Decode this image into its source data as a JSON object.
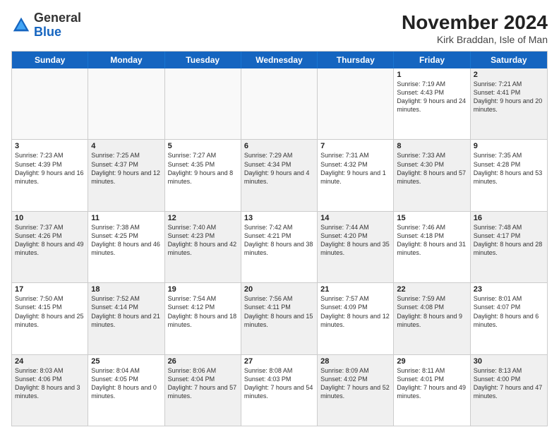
{
  "header": {
    "logo": {
      "line1": "General",
      "line2": "Blue"
    },
    "month_title": "November 2024",
    "subtitle": "Kirk Braddan, Isle of Man"
  },
  "days_of_week": [
    "Sunday",
    "Monday",
    "Tuesday",
    "Wednesday",
    "Thursday",
    "Friday",
    "Saturday"
  ],
  "weeks": [
    [
      {
        "day": "",
        "info": "",
        "empty": true
      },
      {
        "day": "",
        "info": "",
        "empty": true
      },
      {
        "day": "",
        "info": "",
        "empty": true
      },
      {
        "day": "",
        "info": "",
        "empty": true
      },
      {
        "day": "",
        "info": "",
        "empty": true
      },
      {
        "day": "1",
        "info": "Sunrise: 7:19 AM\nSunset: 4:43 PM\nDaylight: 9 hours and 24 minutes.",
        "empty": false,
        "shaded": false
      },
      {
        "day": "2",
        "info": "Sunrise: 7:21 AM\nSunset: 4:41 PM\nDaylight: 9 hours and 20 minutes.",
        "empty": false,
        "shaded": true
      }
    ],
    [
      {
        "day": "3",
        "info": "Sunrise: 7:23 AM\nSunset: 4:39 PM\nDaylight: 9 hours and 16 minutes.",
        "empty": false,
        "shaded": false
      },
      {
        "day": "4",
        "info": "Sunrise: 7:25 AM\nSunset: 4:37 PM\nDaylight: 9 hours and 12 minutes.",
        "empty": false,
        "shaded": true
      },
      {
        "day": "5",
        "info": "Sunrise: 7:27 AM\nSunset: 4:35 PM\nDaylight: 9 hours and 8 minutes.",
        "empty": false,
        "shaded": false
      },
      {
        "day": "6",
        "info": "Sunrise: 7:29 AM\nSunset: 4:34 PM\nDaylight: 9 hours and 4 minutes.",
        "empty": false,
        "shaded": true
      },
      {
        "day": "7",
        "info": "Sunrise: 7:31 AM\nSunset: 4:32 PM\nDaylight: 9 hours and 1 minute.",
        "empty": false,
        "shaded": false
      },
      {
        "day": "8",
        "info": "Sunrise: 7:33 AM\nSunset: 4:30 PM\nDaylight: 8 hours and 57 minutes.",
        "empty": false,
        "shaded": true
      },
      {
        "day": "9",
        "info": "Sunrise: 7:35 AM\nSunset: 4:28 PM\nDaylight: 8 hours and 53 minutes.",
        "empty": false,
        "shaded": false
      }
    ],
    [
      {
        "day": "10",
        "info": "Sunrise: 7:37 AM\nSunset: 4:26 PM\nDaylight: 8 hours and 49 minutes.",
        "empty": false,
        "shaded": true
      },
      {
        "day": "11",
        "info": "Sunrise: 7:38 AM\nSunset: 4:25 PM\nDaylight: 8 hours and 46 minutes.",
        "empty": false,
        "shaded": false
      },
      {
        "day": "12",
        "info": "Sunrise: 7:40 AM\nSunset: 4:23 PM\nDaylight: 8 hours and 42 minutes.",
        "empty": false,
        "shaded": true
      },
      {
        "day": "13",
        "info": "Sunrise: 7:42 AM\nSunset: 4:21 PM\nDaylight: 8 hours and 38 minutes.",
        "empty": false,
        "shaded": false
      },
      {
        "day": "14",
        "info": "Sunrise: 7:44 AM\nSunset: 4:20 PM\nDaylight: 8 hours and 35 minutes.",
        "empty": false,
        "shaded": true
      },
      {
        "day": "15",
        "info": "Sunrise: 7:46 AM\nSunset: 4:18 PM\nDaylight: 8 hours and 31 minutes.",
        "empty": false,
        "shaded": false
      },
      {
        "day": "16",
        "info": "Sunrise: 7:48 AM\nSunset: 4:17 PM\nDaylight: 8 hours and 28 minutes.",
        "empty": false,
        "shaded": true
      }
    ],
    [
      {
        "day": "17",
        "info": "Sunrise: 7:50 AM\nSunset: 4:15 PM\nDaylight: 8 hours and 25 minutes.",
        "empty": false,
        "shaded": false
      },
      {
        "day": "18",
        "info": "Sunrise: 7:52 AM\nSunset: 4:14 PM\nDaylight: 8 hours and 21 minutes.",
        "empty": false,
        "shaded": true
      },
      {
        "day": "19",
        "info": "Sunrise: 7:54 AM\nSunset: 4:12 PM\nDaylight: 8 hours and 18 minutes.",
        "empty": false,
        "shaded": false
      },
      {
        "day": "20",
        "info": "Sunrise: 7:56 AM\nSunset: 4:11 PM\nDaylight: 8 hours and 15 minutes.",
        "empty": false,
        "shaded": true
      },
      {
        "day": "21",
        "info": "Sunrise: 7:57 AM\nSunset: 4:09 PM\nDaylight: 8 hours and 12 minutes.",
        "empty": false,
        "shaded": false
      },
      {
        "day": "22",
        "info": "Sunrise: 7:59 AM\nSunset: 4:08 PM\nDaylight: 8 hours and 9 minutes.",
        "empty": false,
        "shaded": true
      },
      {
        "day": "23",
        "info": "Sunrise: 8:01 AM\nSunset: 4:07 PM\nDaylight: 8 hours and 6 minutes.",
        "empty": false,
        "shaded": false
      }
    ],
    [
      {
        "day": "24",
        "info": "Sunrise: 8:03 AM\nSunset: 4:06 PM\nDaylight: 8 hours and 3 minutes.",
        "empty": false,
        "shaded": true
      },
      {
        "day": "25",
        "info": "Sunrise: 8:04 AM\nSunset: 4:05 PM\nDaylight: 8 hours and 0 minutes.",
        "empty": false,
        "shaded": false
      },
      {
        "day": "26",
        "info": "Sunrise: 8:06 AM\nSunset: 4:04 PM\nDaylight: 7 hours and 57 minutes.",
        "empty": false,
        "shaded": true
      },
      {
        "day": "27",
        "info": "Sunrise: 8:08 AM\nSunset: 4:03 PM\nDaylight: 7 hours and 54 minutes.",
        "empty": false,
        "shaded": false
      },
      {
        "day": "28",
        "info": "Sunrise: 8:09 AM\nSunset: 4:02 PM\nDaylight: 7 hours and 52 minutes.",
        "empty": false,
        "shaded": true
      },
      {
        "day": "29",
        "info": "Sunrise: 8:11 AM\nSunset: 4:01 PM\nDaylight: 7 hours and 49 minutes.",
        "empty": false,
        "shaded": false
      },
      {
        "day": "30",
        "info": "Sunrise: 8:13 AM\nSunset: 4:00 PM\nDaylight: 7 hours and 47 minutes.",
        "empty": false,
        "shaded": true
      }
    ]
  ]
}
